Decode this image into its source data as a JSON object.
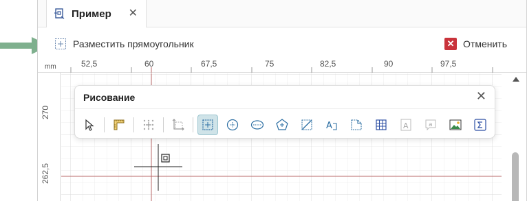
{
  "tab": {
    "title": "Пример",
    "close_icon": "close-icon",
    "icon": "drawing-document-icon"
  },
  "command": {
    "place_label": "Разместить прямоугольник",
    "place_icon": "rectangle-place-icon",
    "cancel_label": "Отменить",
    "cancel_icon": "cancel-x-icon",
    "cancel_color": "#c9333b"
  },
  "ruler": {
    "unit": "mm",
    "top_ticks": [
      "52,5",
      "60",
      "67,5",
      "75",
      "82,5",
      "90",
      "97,5"
    ],
    "left_ticks": [
      "270",
      "262,5"
    ]
  },
  "draw_panel": {
    "title": "Рисование",
    "close_icon": "close-icon",
    "tools": [
      "select-arrow-icon",
      "ruler-icon",
      "snap-points-icon",
      "move-rotate-icon",
      "rectangle-icon",
      "circle-icon",
      "ellipse-icon",
      "polygon-icon",
      "hatch-icon",
      "text-icon",
      "page-corner-icon",
      "table-icon",
      "text-box-icon",
      "callout-icon",
      "image-icon",
      "formula-icon"
    ],
    "active_tool": "rectangle-icon"
  },
  "colors": {
    "accent": "#7fb08e",
    "active_tool_bg": "#cfe3e8",
    "guide_line": "#b86a6a"
  }
}
